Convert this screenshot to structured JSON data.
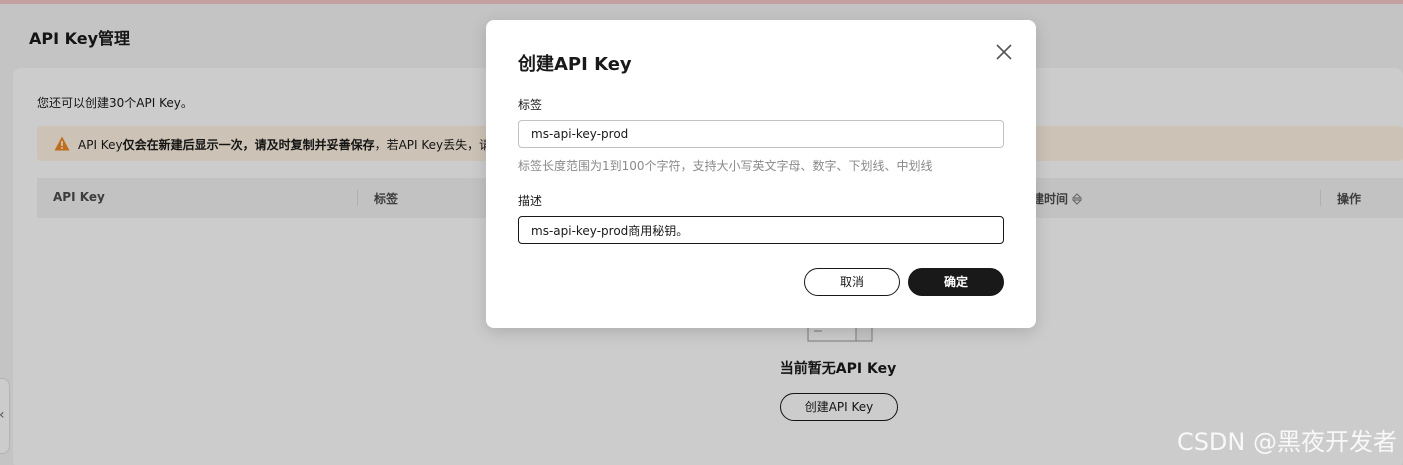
{
  "page": {
    "title": "API Key管理"
  },
  "content": {
    "quota_text": "您还可以创建30个API Key。",
    "warning": {
      "prefix": "API Key",
      "bold": "仅会在新建后显示一次，请及时复制并妥善保存",
      "suffix": "，若API Key丢失，请",
      "icon": "warning-triangle-icon",
      "color": "#f08a24"
    },
    "table": {
      "columns": [
        "API Key",
        "标签",
        "建时间",
        "操作"
      ]
    },
    "empty_state": {
      "title": "当前暂无API Key",
      "button": "创建API Key"
    }
  },
  "dialog": {
    "title": "创建API Key",
    "label_field": {
      "label": "标签",
      "value": "ms-api-key-prod",
      "hint": "标签长度范围为1到100个字符，支持大小写英文字母、数字、下划线、中划线"
    },
    "description_field": {
      "label": "描述",
      "value": "ms-api-key-prod商用秘钥。"
    },
    "cancel_label": "取消",
    "ok_label": "确定"
  },
  "watermark": "CSDN @黑夜开发者"
}
